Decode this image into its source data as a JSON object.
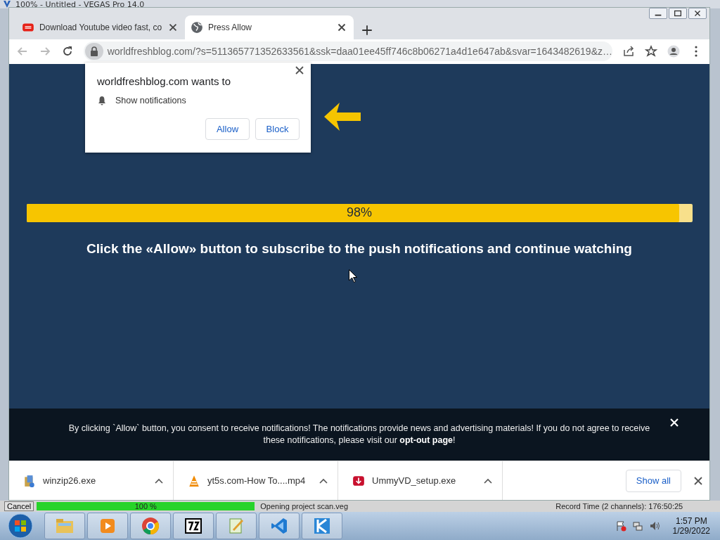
{
  "background_window": {
    "title": "100% - Untitled - VEGAS Pro 14.0",
    "status_bar": {
      "cancel_button": "Cancel",
      "progress": {
        "level": 1.0,
        "reading": "100 %"
      },
      "message": "Opening project scan.veg",
      "record_time": "Record Time (2 channels): 176:50:25"
    }
  },
  "browser": {
    "tabs": [
      {
        "title": "Download Youtube video fast, co",
        "kind": "youtube",
        "selected": false
      },
      {
        "title": "Press Allow",
        "kind": "globe",
        "selected": true
      }
    ],
    "address_bar": {
      "url": "worldfreshblog.com/?s=511365771352633561&ssk=daa01ee45ff746c8b06271a4d1e647ab&svar=1643482619&z…"
    },
    "permission_prompt": {
      "title": "worldfreshblog.com wants to",
      "permission": "Show notifications",
      "buttons": [
        "Allow",
        "Block"
      ]
    },
    "page": {
      "progress": {
        "level": 0.98,
        "reading": "98%"
      },
      "message": "Click the «Allow» button to subscribe to the push notifications and continue watching",
      "consent_banner": {
        "text": "By clicking `Allow` button, you consent to receive notifications! The notifications provide news and advertising materials! If you do not agree to receive these notifications, please visit our",
        "link": "opt-out page",
        "after": "!"
      }
    },
    "downloads": [
      {
        "name": "winzip26.exe",
        "kind": "installer"
      },
      {
        "name": "yt5s.com-How To....mp4",
        "kind": "video"
      },
      {
        "name": "UmmyVD_setup.exe",
        "kind": "download"
      }
    ],
    "show_all_button": "Show all"
  },
  "taskbar": {
    "apps": [
      {
        "kind": "folder"
      },
      {
        "kind": "player"
      },
      {
        "kind": "chrome"
      },
      {
        "kind": "archive"
      },
      {
        "kind": "notepad"
      },
      {
        "kind": "vscode"
      },
      {
        "kind": "editor"
      }
    ],
    "clock": {
      "time": "1:57 PM",
      "date": "1/29/2022"
    }
  }
}
